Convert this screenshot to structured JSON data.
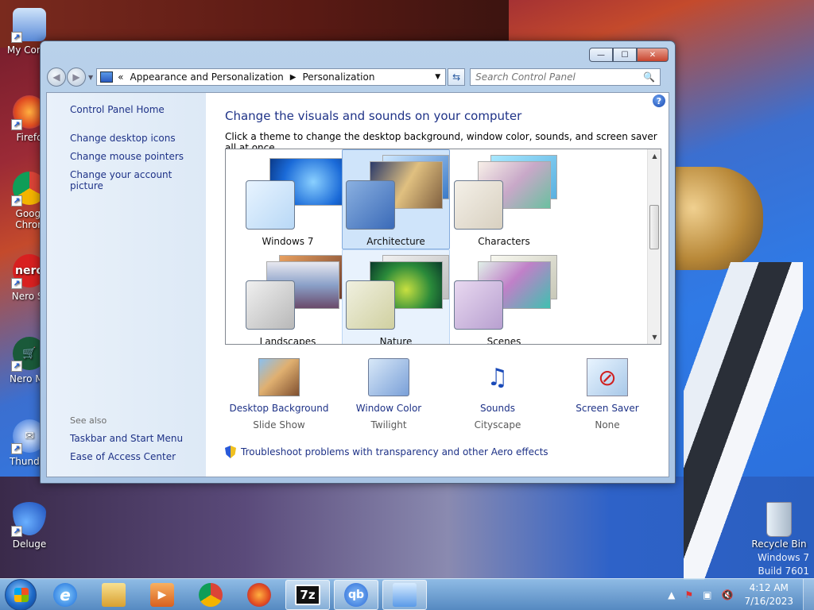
{
  "desktop": {
    "icons": [
      {
        "label": "My Comp",
        "icon": "computer-icon"
      },
      {
        "label": "Firefo",
        "icon": "firefox-icon"
      },
      {
        "label": "Googl\nChron",
        "icon": "chrome-icon"
      },
      {
        "label": "Nero St",
        "icon": "nero-icon"
      },
      {
        "label": "Nero Ma",
        "icon": "nero-manager-icon"
      },
      {
        "label": "Thunder",
        "icon": "thunderbird-icon"
      },
      {
        "label": "Deluge",
        "icon": "deluge-icon"
      }
    ],
    "recycle_bin": "Recycle Bin",
    "watermark_line1": "Windows 7",
    "watermark_line2": "Build 7601"
  },
  "window": {
    "caption_buttons": {
      "minimize": "—",
      "maximize": "☐",
      "close": "✕"
    },
    "address": {
      "overflow": "«",
      "crumb1": "Appearance and Personalization",
      "crumb2": "Personalization"
    },
    "search_placeholder": "Search Control Panel",
    "left_pane": {
      "home": "Control Panel Home",
      "links": [
        "Change desktop icons",
        "Change mouse pointers",
        "Change your account picture"
      ],
      "see_also_header": "See also",
      "see_also": [
        "Taskbar and Start Menu",
        "Ease of Access Center"
      ]
    },
    "main": {
      "title": "Change the visuals and sounds on your computer",
      "subtitle": "Click a theme to change the desktop background, window color, sounds, and screen saver all at once.",
      "themes": [
        "Windows 7",
        "Architecture",
        "Characters",
        "Landscapes",
        "Nature",
        "Scenes"
      ],
      "selected_theme": "Architecture",
      "hovered_theme": "Nature",
      "bottom": [
        {
          "label": "Desktop Background",
          "value": "Slide Show"
        },
        {
          "label": "Window Color",
          "value": "Twilight"
        },
        {
          "label": "Sounds",
          "value": "Cityscape"
        },
        {
          "label": "Screen Saver",
          "value": "None"
        }
      ],
      "aero_link": "Troubleshoot problems with transparency and other Aero effects",
      "help": "?"
    }
  },
  "taskbar": {
    "apps": [
      "internet-explorer",
      "explorer",
      "media-player",
      "chrome",
      "firefox",
      "7zip",
      "qbittorrent",
      "control-panel"
    ],
    "labels": {
      "sevenzip": "7z",
      "qbit": "qb"
    },
    "time": "4:12 AM",
    "date": "7/16/2023"
  },
  "colors": {
    "link": "#1e3287",
    "selected_theme_bg": "#cfe4fa",
    "title_blue": "#1e3287"
  }
}
